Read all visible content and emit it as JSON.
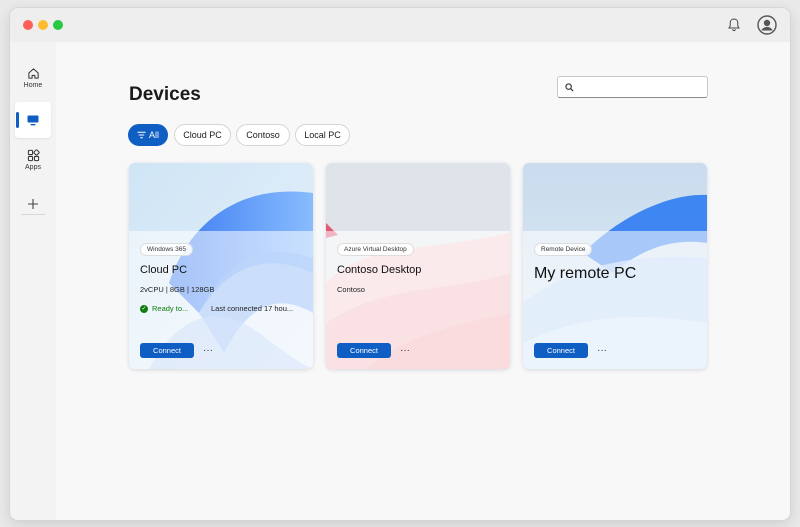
{
  "sidebar": {
    "items": [
      {
        "label": "Home",
        "icon": "home-icon"
      },
      {
        "label": "",
        "icon": "devices-icon"
      },
      {
        "label": "Apps",
        "icon": "apps-icon"
      }
    ]
  },
  "page": {
    "title": "Devices"
  },
  "search": {
    "placeholder": ""
  },
  "filters": [
    "All",
    "Cloud PC",
    "Contoso",
    "Local PC"
  ],
  "cards": [
    {
      "badge": "Windows 365",
      "name": "Cloud PC",
      "spec": "2vCPU | 8GB | 128GB",
      "status": "Ready to...",
      "last_connected": "Last connected 17 hou...",
      "connect": "Connect",
      "more": "···"
    },
    {
      "badge": "Azure Virtual Desktop",
      "name": "Contoso Desktop",
      "spec": "Contoso",
      "connect": "Connect",
      "more": "···"
    },
    {
      "badge": "Remote Device",
      "name": "My remote PC",
      "connect": "Connect",
      "more": "···"
    }
  ],
  "colors": {
    "accent": "#0f5ec4",
    "status_ok": "#107c10"
  }
}
